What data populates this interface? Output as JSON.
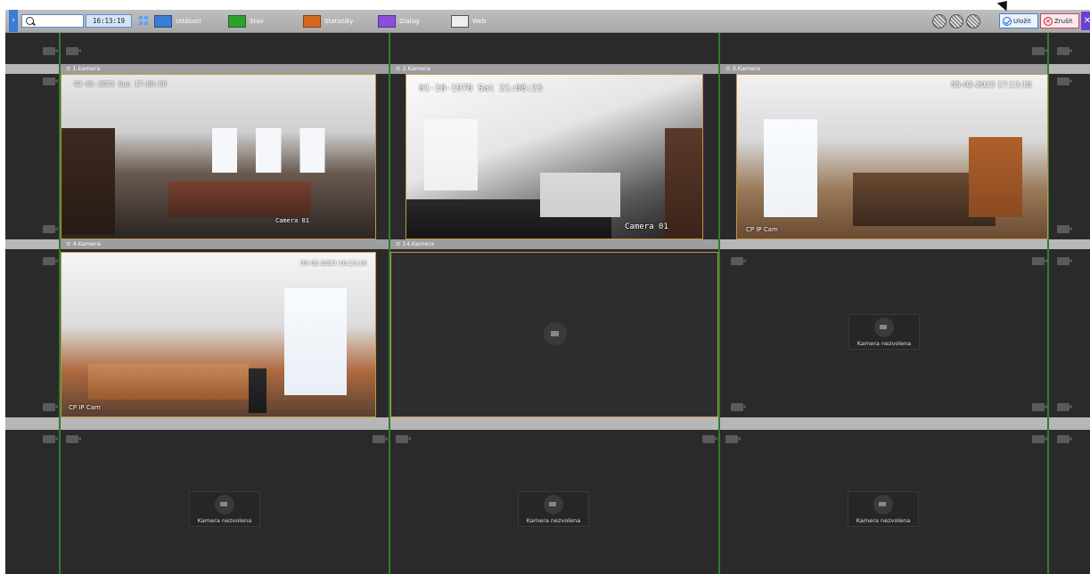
{
  "toolbar": {
    "clock": "16:13:19",
    "events_label": "Události",
    "status_label": "Stav",
    "stats_label": "Statistiky",
    "dialog_label": "Dialog",
    "web_label": "Web",
    "save_label": "Uložit",
    "cancel_label": "Zrušit"
  },
  "cameras": [
    {
      "title": "1.kamera",
      "timestamp": "02-05-2023 Sun 17:08:50",
      "label": "Camera 01"
    },
    {
      "title": "2.Kamera",
      "timestamp": "01-10-1970 Sat 21:08:23",
      "label": "Camera 01"
    },
    {
      "title": "3.Kamera",
      "timestamp": "05-02-2023 17:13:18",
      "label": "CP IP Cam"
    },
    {
      "title": "4.Kamera",
      "timestamp": "05-02-2023 16:13:18",
      "label": "CP IP Cam"
    },
    {
      "title": "14.Kamera"
    }
  ],
  "empty_label": "Kamera nezvolena",
  "colors": {
    "accent": "#3a7bd5",
    "grid_line": "#2f7d2f",
    "tile_border": "#c0954a"
  }
}
